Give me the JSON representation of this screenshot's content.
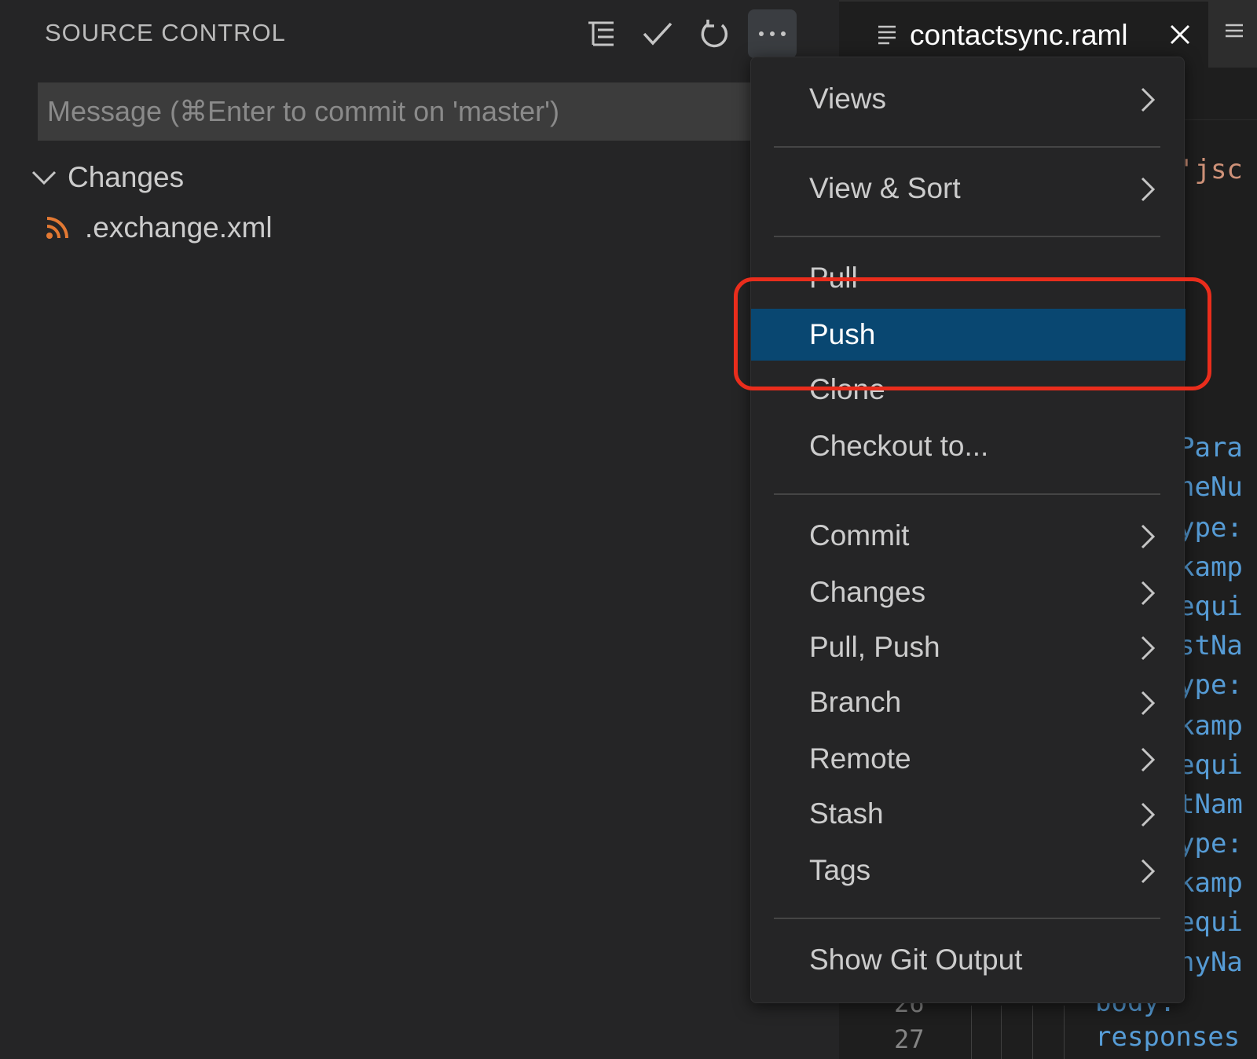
{
  "sidebar": {
    "title": "SOURCE CONTROL",
    "toolbar": [
      {
        "name": "view-as-tree-icon",
        "label": "View as Tree"
      },
      {
        "name": "check-icon",
        "label": "Commit"
      },
      {
        "name": "refresh-icon",
        "label": "Refresh"
      },
      {
        "name": "more-actions-icon",
        "label": "More Actions"
      }
    ],
    "commit_input": {
      "placeholder": "Message (⌘Enter to commit on 'master')",
      "value": ""
    },
    "changes_group": {
      "label": "Changes",
      "expanded": true
    },
    "files": [
      {
        "name": ".exchange.xml",
        "icon": "rss-icon",
        "icon_color": "#e37933"
      }
    ]
  },
  "editor": {
    "tab": {
      "label": "contactsync.raml",
      "icon": "file-lines-icon"
    },
    "code_fragments": [
      {
        "text": "'jsc",
        "style": "orange",
        "y": 0
      },
      {
        "text": "Para",
        "style": "blue"
      },
      {
        "text": "neNu",
        "style": "blue"
      },
      {
        "text": "ype:",
        "style": "blue"
      },
      {
        "text": "kamp",
        "style": "blue"
      },
      {
        "text": "equi",
        "style": "blue"
      },
      {
        "text": "stNa",
        "style": "blue"
      },
      {
        "text": "ype:",
        "style": "blue"
      },
      {
        "text": "kamp",
        "style": "blue"
      },
      {
        "text": "equi",
        "style": "blue"
      },
      {
        "text": "tNam",
        "style": "blue"
      },
      {
        "text": "ype:",
        "style": "blue"
      },
      {
        "text": "kamp",
        "style": "blue"
      },
      {
        "text": "equi",
        "style": "blue"
      },
      {
        "text": "nyNa",
        "style": "blue"
      },
      {
        "text": "body:",
        "style": "blue"
      },
      {
        "text": "responses",
        "style": "blue"
      }
    ],
    "gutter": [
      "26",
      "27"
    ]
  },
  "menu": {
    "items": [
      {
        "label": "Views",
        "submenu": true
      },
      {
        "label": "View & Sort",
        "submenu": true
      },
      {
        "label": "Pull",
        "submenu": false
      },
      {
        "label": "Push",
        "submenu": false,
        "selected": true
      },
      {
        "label": "Clone",
        "submenu": false
      },
      {
        "label": "Checkout to...",
        "submenu": false
      },
      {
        "label": "Commit",
        "submenu": true
      },
      {
        "label": "Changes",
        "submenu": true
      },
      {
        "label": "Pull, Push",
        "submenu": true
      },
      {
        "label": "Branch",
        "submenu": true
      },
      {
        "label": "Remote",
        "submenu": true
      },
      {
        "label": "Stash",
        "submenu": true
      },
      {
        "label": "Tags",
        "submenu": true
      },
      {
        "label": "Show Git Output",
        "submenu": false
      }
    ]
  },
  "colors": {
    "selection": "#094771",
    "annotation_outline": "#ea2d1c",
    "sidebar_bg": "#252526",
    "editor_bg": "#1e1e1e"
  }
}
